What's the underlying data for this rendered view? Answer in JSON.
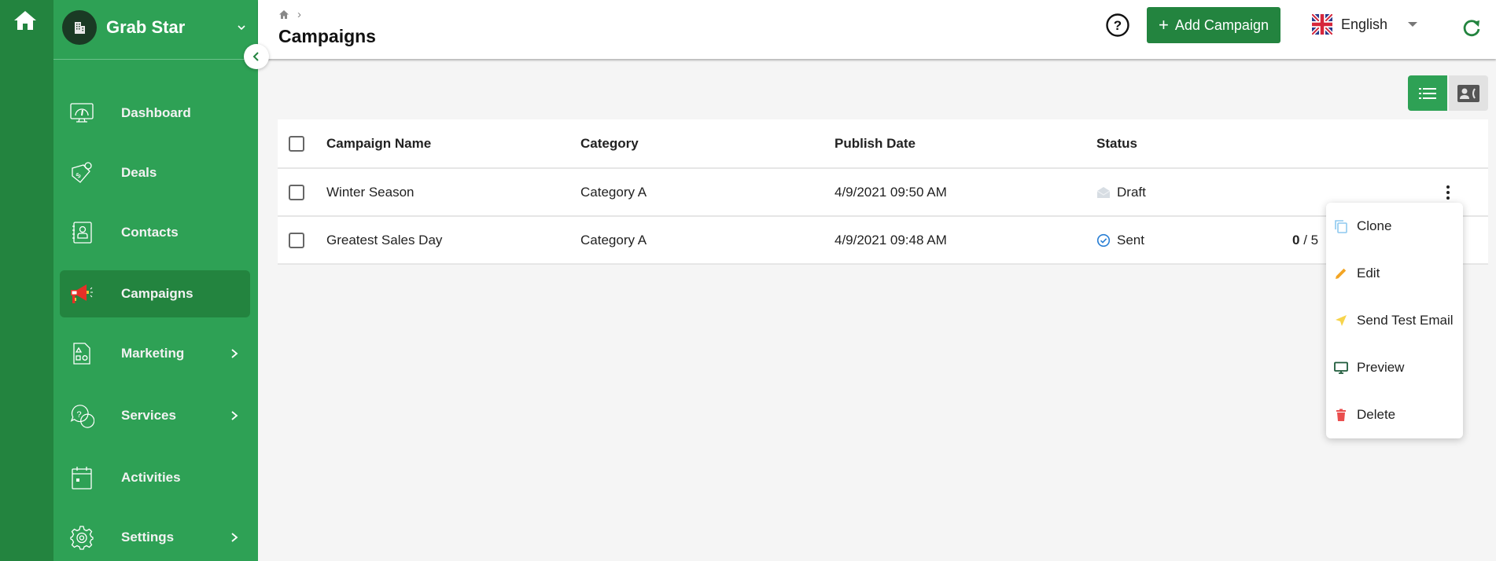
{
  "app": {
    "brand_name": "Grab Star"
  },
  "sidebar": {
    "items": [
      {
        "label": "Dashboard",
        "icon": "dashboard-gauge-icon",
        "has_submenu": false,
        "active": false
      },
      {
        "label": "Deals",
        "icon": "price-tag-icon",
        "has_submenu": false,
        "active": false
      },
      {
        "label": "Contacts",
        "icon": "contact-book-icon",
        "has_submenu": false,
        "active": false
      },
      {
        "label": "Campaigns",
        "icon": "megaphone-icon",
        "has_submenu": false,
        "active": true
      },
      {
        "label": "Marketing",
        "icon": "shapes-document-icon",
        "has_submenu": true,
        "active": false
      },
      {
        "label": "Services",
        "icon": "chat-question-icon",
        "has_submenu": true,
        "active": false
      },
      {
        "label": "Activities",
        "icon": "calendar-icon",
        "has_submenu": false,
        "active": false
      },
      {
        "label": "Settings",
        "icon": "gear-icon",
        "has_submenu": true,
        "active": false
      }
    ]
  },
  "header": {
    "breadcrumb_separator": "›",
    "title": "Campaigns",
    "add_button_label": "Add Campaign",
    "add_button_plus": "+",
    "language": "English"
  },
  "table": {
    "columns": [
      "Campaign Name",
      "Category",
      "Publish Date",
      "Status"
    ],
    "rows": [
      {
        "name": "Winter Season",
        "category": "Category A",
        "publish_date": "4/9/2021 09:50 AM",
        "status": "Draft",
        "status_icon": "envelope-open-icon",
        "count_done": "",
        "count_total": ""
      },
      {
        "name": "Greatest Sales Day",
        "category": "Category A",
        "publish_date": "4/9/2021 09:48 AM",
        "status": "Sent",
        "status_icon": "check-circle-icon",
        "count_done": "0",
        "count_total": "/ 5"
      }
    ]
  },
  "context_menu": {
    "items": [
      {
        "label": "Clone",
        "icon": "copy-icon",
        "color": "#8ec9ef"
      },
      {
        "label": "Edit",
        "icon": "pencil-icon",
        "color": "#f3a524"
      },
      {
        "label": "Send Test Email",
        "icon": "send-icon",
        "color": "#f7d44c"
      },
      {
        "label": "Preview",
        "icon": "monitor-icon",
        "color": "#1e5b3b"
      },
      {
        "label": "Delete",
        "icon": "trash-icon",
        "color": "#ea4e4e"
      }
    ]
  },
  "colors": {
    "primary": "#2ea155",
    "primary_dark": "#23843f",
    "rail": "#23843f"
  }
}
